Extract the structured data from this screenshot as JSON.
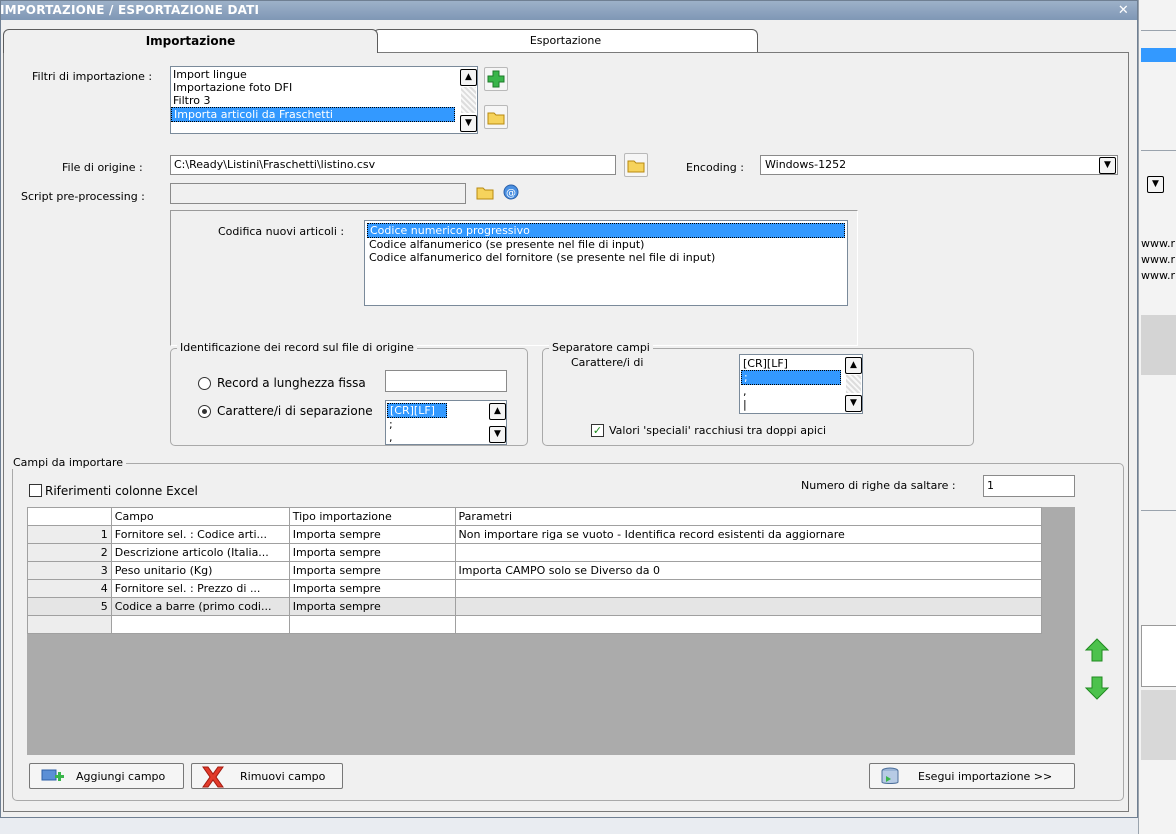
{
  "window": {
    "title": "IMPORTAZIONE / ESPORTAZIONE DATI"
  },
  "tabs": [
    {
      "label": "Importazione",
      "active": true
    },
    {
      "label": "Esportazione",
      "active": false
    }
  ],
  "filtri": {
    "label": "Filtri di importazione :",
    "items": [
      "Import lingue",
      "Importazione foto DFI",
      "Filtro 3",
      "Importa articoli da Fraschetti"
    ],
    "selected_index": 3
  },
  "file": {
    "label": "File di origine :",
    "value": "C:\\Ready\\Listini\\Fraschetti\\listino.csv"
  },
  "encoding": {
    "label": "Encoding :",
    "value": "Windows-1252"
  },
  "script": {
    "label": "Script pre-processing :",
    "value": ""
  },
  "codifica": {
    "label": "Codifica nuovi articoli :",
    "items": [
      "Codice numerico progressivo",
      "Codice alfanumerico (se presente nel file di input)",
      "Codice alfanumerico del fornitore (se presente nel file di input)"
    ]
  },
  "identificazione": {
    "title": "Identificazione dei record sul file di origine",
    "opt_fixed": "Record a lunghezza fissa",
    "opt_sep": "Carattere/i di separazione",
    "sep_items": [
      "[CR][LF]",
      ";",
      ","
    ]
  },
  "separatore": {
    "title": "Separatore campi",
    "label": "Carattere/i di",
    "items": [
      "[CR][LF]",
      ";",
      ",",
      "|"
    ],
    "check_label": "Valori 'speciali' racchiusi tra doppi apici"
  },
  "campi": {
    "title": "Campi da importare",
    "excel_label": "Riferimenti colonne Excel",
    "righe_label": "Numero di righe da saltare :",
    "righe_value": "1",
    "columns": [
      "Campo",
      "Tipo importazione",
      "Parametri"
    ],
    "rows": [
      {
        "n": "1",
        "campo": "Fornitore sel. : Codice arti...",
        "tipo": "Importa sempre",
        "param": "Non importare riga se vuoto - Identifica record esistenti da aggiornare"
      },
      {
        "n": "2",
        "campo": "Descrizione articolo (Italia...",
        "tipo": "Importa sempre",
        "param": ""
      },
      {
        "n": "3",
        "campo": "Peso unitario (Kg)",
        "tipo": "Importa sempre",
        "param": "Importa CAMPO solo se Diverso da 0"
      },
      {
        "n": "4",
        "campo": "Fornitore sel. : Prezzo di ...",
        "tipo": "Importa sempre",
        "param": ""
      },
      {
        "n": "5",
        "campo": "Codice a barre (primo codi...",
        "tipo": "Importa sempre",
        "param": ""
      }
    ]
  },
  "buttons": {
    "aggiungi": "Aggiungi campo",
    "rimuovi": "Rimuovi campo",
    "esegui": "Esegui importazione >>"
  },
  "bg_app": {
    "rows": [
      "www.r",
      "www.r",
      "www.r"
    ]
  }
}
